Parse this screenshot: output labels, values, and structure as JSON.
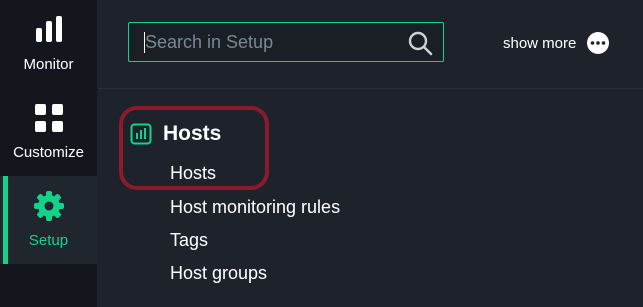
{
  "sidebar": {
    "items": [
      {
        "label": "Monitor",
        "icon": "bar-chart-icon"
      },
      {
        "label": "Customize",
        "icon": "grid-icon"
      },
      {
        "label": "Setup",
        "icon": "gear-icon",
        "active": true
      }
    ]
  },
  "search": {
    "placeholder": "Search in Setup",
    "value": ""
  },
  "topbar": {
    "show_more_label": "show more"
  },
  "section": {
    "title": "Hosts",
    "icon": "hosts-icon",
    "items": [
      "Hosts",
      "Host monitoring rules",
      "Tags",
      "Host groups"
    ]
  },
  "colors": {
    "accent": "#13d389",
    "sidebar_bg": "#13171d",
    "main_bg": "#1e232b",
    "highlight": "#8b1a2c"
  }
}
